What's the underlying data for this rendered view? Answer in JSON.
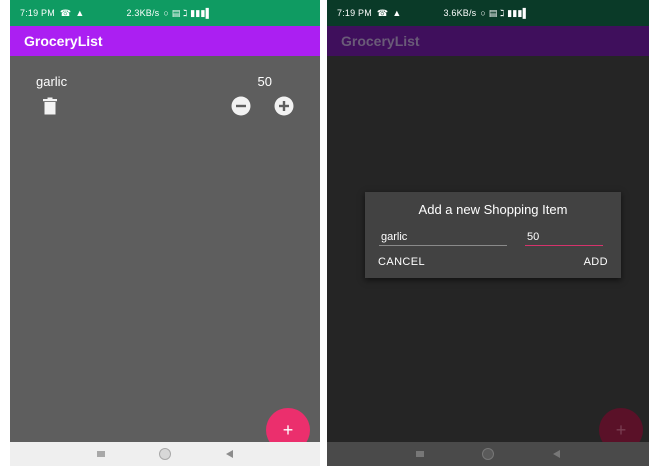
{
  "status_left": {
    "time": "7:19 PM",
    "net_speed": "2.3KB/s",
    "call_glyph": "☎",
    "alert_glyph": "▲",
    "icons": "○ ▤ ℷ ▮▮▮▌"
  },
  "status_right": {
    "time": "7:19 PM",
    "net_speed": "3.6KB/s",
    "call_glyph": "☎",
    "alert_glyph": "▲",
    "icons": "○ ▤ ℷ ▮▮▮▌"
  },
  "app": {
    "title": "GroceryList"
  },
  "item": {
    "name": "garlic",
    "amount": "50"
  },
  "fab_glyph": "+",
  "dialog": {
    "title": "Add a new Shopping Item",
    "name_value": "garlic",
    "amount_value": "50",
    "cancel_label": "CANCEL",
    "add_label": "ADD"
  },
  "icons": {
    "delete": "trash-icon",
    "minus": "minus-circle-icon",
    "plus": "plus-circle-icon",
    "fab": "add-icon",
    "nav_recents": "square-icon",
    "nav_home": "circle-icon",
    "nav_back": "triangle-back-icon"
  },
  "colors": {
    "status_bar": "#0f9b62",
    "app_bar": "#ab1ff2",
    "content_bg": "#5e5e5e",
    "fab": "#eb2f6d",
    "dialog_bg": "#424242",
    "dim_content_bg": "#252525"
  }
}
